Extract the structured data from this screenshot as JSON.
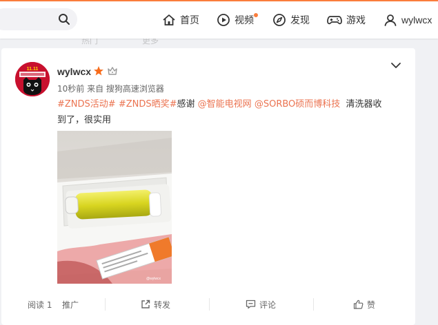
{
  "header": {
    "search": {
      "placeholder": ""
    },
    "nav": {
      "home": "首页",
      "video": "视频",
      "discover": "发现",
      "games": "游戏",
      "user": "wylwcx"
    },
    "accent": "#fa7d3c"
  },
  "subbar": {
    "item1": "热门",
    "item2": "更多"
  },
  "post": {
    "username": "wylwcx",
    "meta": "10秒前 来自 搜狗高速浏览器",
    "tag1": "#ZNDS活动#",
    "tag2": "#ZNDS晒奖#",
    "text_thanks": "感谢",
    "mention1": "@智能电视网",
    "mention2": "@SORBO硕而博科技",
    "text_line1_end": "清洗器收",
    "text_line2": "到了，很实用",
    "image_alt": "洗鼻器产品照片",
    "colors": {
      "link": "#eb7350",
      "avatar": "#c8102e"
    }
  },
  "actions": {
    "reads": "阅读 1",
    "promote": "推广",
    "repost": "转发",
    "comment": "评论",
    "like": "赞"
  }
}
